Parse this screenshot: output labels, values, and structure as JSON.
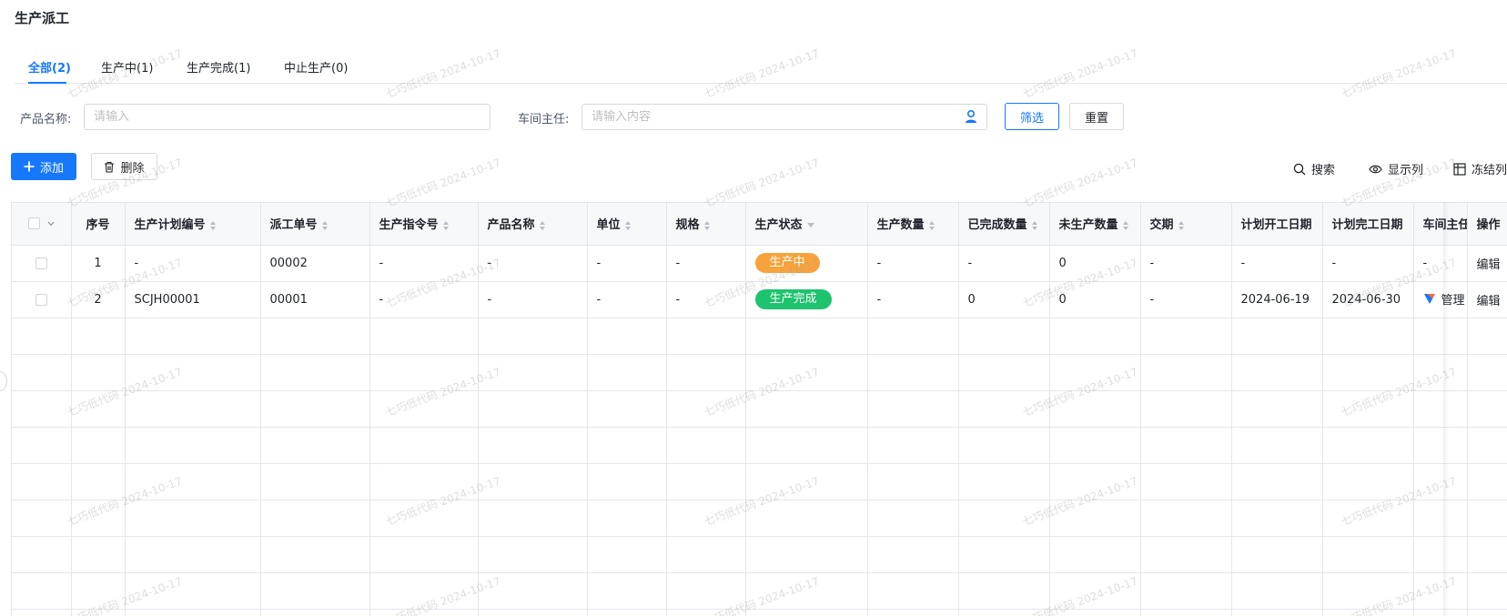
{
  "page": {
    "title": "生产派工"
  },
  "tabs": [
    {
      "label": "全部(2)",
      "active": true
    },
    {
      "label": "生产中(1)",
      "active": false
    },
    {
      "label": "生产完成(1)",
      "active": false
    },
    {
      "label": "中止生产(0)",
      "active": false
    }
  ],
  "filters": {
    "product_name_label": "产品名称:",
    "product_name_placeholder": "请输入",
    "supervisor_label": "车间主任:",
    "supervisor_placeholder": "请输入内容",
    "filter_button": "筛选",
    "reset_button": "重置"
  },
  "toolbar": {
    "add_button": "添加",
    "delete_button": "删除",
    "search": "搜索",
    "columns": "显示列",
    "freeze": "冻结列"
  },
  "table": {
    "headers": [
      "序号",
      "生产计划编号",
      "派工单号",
      "生产指令号",
      "产品名称",
      "单位",
      "规格",
      "生产状态",
      "生产数量",
      "已完成数量",
      "未生产数量",
      "交期",
      "计划开工日期",
      "计划完工日期",
      "车间主任",
      "操作"
    ],
    "rows": [
      {
        "index": "1",
        "plan_no": "-",
        "dispatch_no": "00002",
        "order_no": "-",
        "product": "-",
        "unit": "-",
        "spec": "-",
        "status": "生产中",
        "status_color": "#f7a23b",
        "qty": "-",
        "done_qty": "-",
        "pending_qty": "0",
        "due": "-",
        "plan_start": "-",
        "plan_end": "-",
        "supervisor": "-",
        "action": "编辑"
      },
      {
        "index": "2",
        "plan_no": "SCJH00001",
        "dispatch_no": "00001",
        "order_no": "-",
        "product": "-",
        "unit": "-",
        "spec": "-",
        "status": "生产完成",
        "status_color": "#1ec36d",
        "qty": "-",
        "done_qty": "0",
        "pending_qty": "0",
        "due": "-",
        "plan_start": "2024-06-19",
        "plan_end": "2024-06-30",
        "supervisor": "管理",
        "action": "编辑"
      }
    ]
  },
  "watermark": {
    "text": "七巧低代码 2024-10-17"
  },
  "colors": {
    "primary": "#1677ff",
    "border": "#e5e6eb",
    "header_bg": "#f7f8fa"
  }
}
